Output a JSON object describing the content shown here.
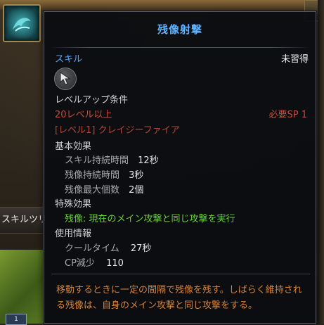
{
  "background": {
    "skill_tree_tab_label": "スキルツリ",
    "bottom_badge_label": "1"
  },
  "tooltip": {
    "title": "残像射撃",
    "skill_type": "スキル",
    "learned_status": "未習得",
    "skill_icon": "cursor-arrow-icon",
    "level_up": {
      "header": "レベルアップ条件",
      "required_level": "20レベル以上",
      "required_sp": "必要SP 1",
      "required_skill": "[レベル1] クレイジーファイア"
    },
    "basic_effects": {
      "header": "基本効果",
      "rows": [
        {
          "label": "スキル持続時間",
          "value": "12秒"
        },
        {
          "label": "残像持続時間",
          "value": "3秒"
        },
        {
          "label": "残像最大個数",
          "value": "2個"
        }
      ]
    },
    "special_effects": {
      "header": "特殊効果",
      "text": "残像: 現在のメイン攻撃と同じ攻撃を実行"
    },
    "usage_info": {
      "header": "使用情報",
      "rows": [
        {
          "label": "クールタイム",
          "value": "27秒"
        },
        {
          "label": "CP減少",
          "value": "110"
        }
      ]
    },
    "description": "移動するときに一定の間隔で残像を残す。しばらく維持される残像は、自身のメイン攻撃と同じ攻撃をする。"
  },
  "colors": {
    "title": "#5fb2ff",
    "requirement_unmet": "#c84a3a",
    "special_effect": "#66d13a",
    "description": "#d7833a"
  }
}
